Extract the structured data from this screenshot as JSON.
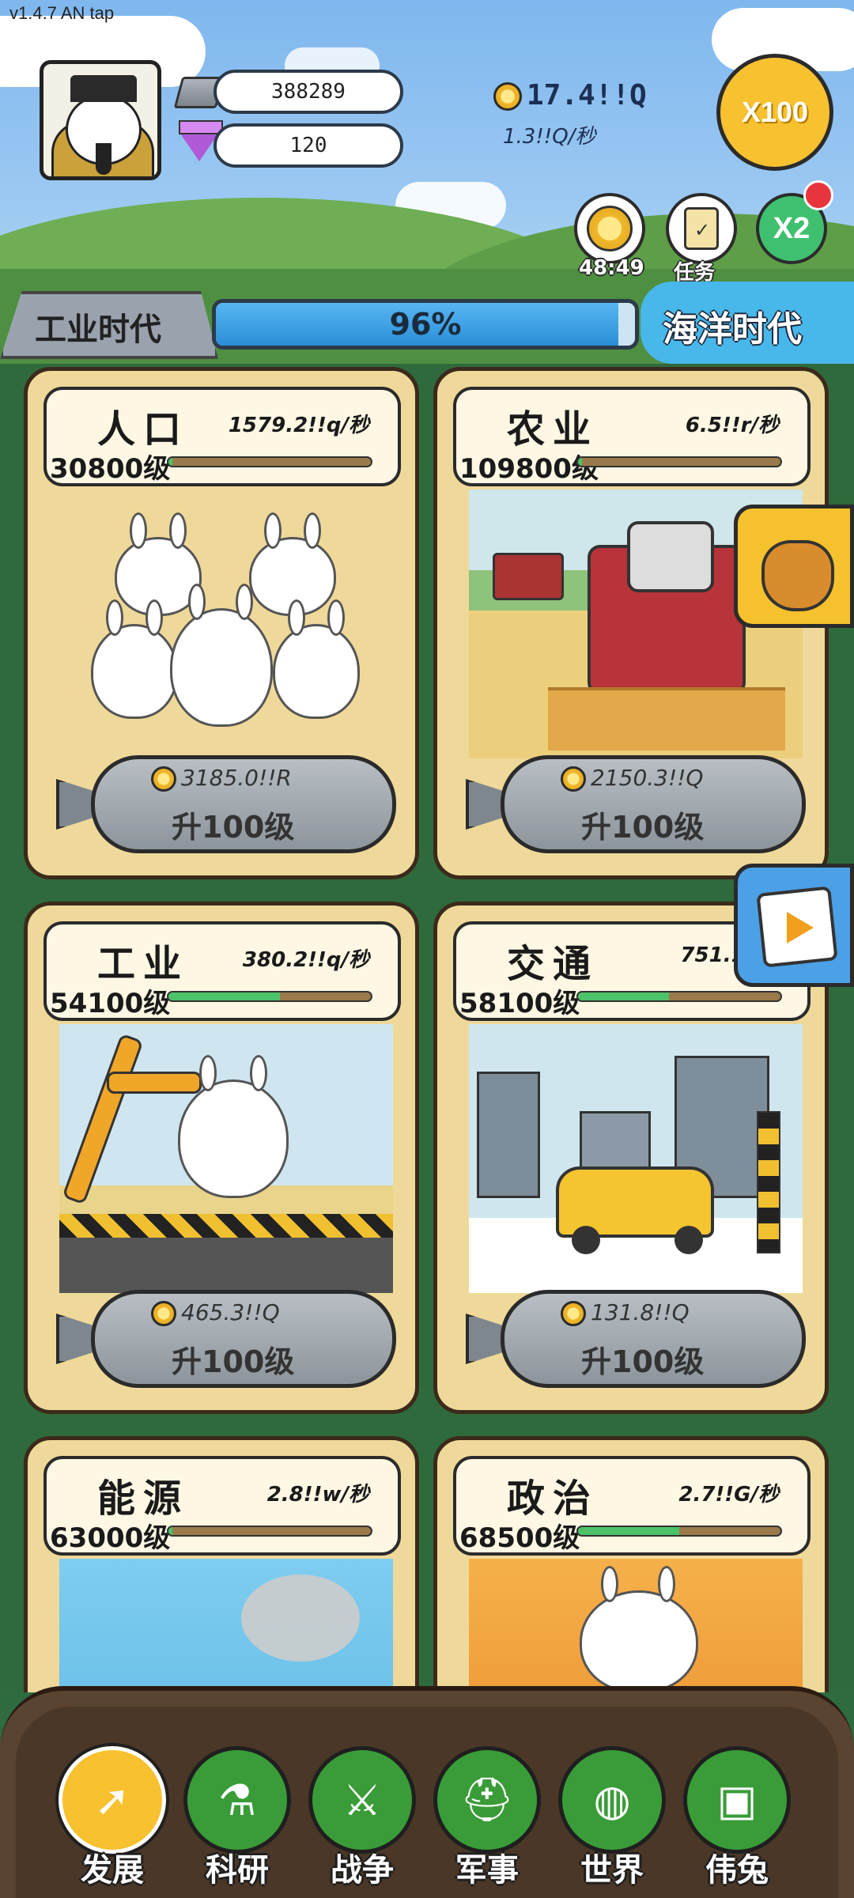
{
  "version": "v1.4.7 AN tap",
  "resources": {
    "silver": "388289",
    "gems": "120",
    "gold_total": "17.4!!Q",
    "gold_rate": "1.3!!Q/秒"
  },
  "buttons": {
    "x100": "X100",
    "timer": "48:49",
    "task": "任务",
    "x2": "X2"
  },
  "era": {
    "current": "工业时代",
    "progress_text": "96%",
    "progress": 0.96,
    "next": "海洋时代"
  },
  "cards": [
    {
      "title": "人口",
      "rate": "1579.2!!q/秒",
      "level": "30800级",
      "cost": "3185.0!!R",
      "upgrade": "升100级",
      "level_fill": 0.02
    },
    {
      "title": "农业",
      "rate": "6.5!!r/秒",
      "level": "109800级",
      "cost": "2150.3!!Q",
      "upgrade": "升100级",
      "level_fill": 0.02
    },
    {
      "title": "工业",
      "rate": "380.2!!q/秒",
      "level": "54100级",
      "cost": "465.3!!Q",
      "upgrade": "升100级",
      "level_fill": 0.55
    },
    {
      "title": "交通",
      "rate": "751.1!!q",
      "level": "58100级",
      "cost": "131.8!!Q",
      "upgrade": "升100级",
      "level_fill": 0.45
    },
    {
      "title": "能源",
      "rate": "2.8!!w/秒",
      "level": "63000级",
      "cost": "",
      "upgrade": "",
      "level_fill": 0.02
    },
    {
      "title": "政治",
      "rate": "2.7!!G/秒",
      "level": "68500级",
      "cost": "",
      "upgrade": "",
      "level_fill": 0.5
    }
  ],
  "nav": [
    {
      "label": "发展",
      "icon": "development-icon"
    },
    {
      "label": "科研",
      "icon": "research-icon"
    },
    {
      "label": "战争",
      "icon": "war-icon"
    },
    {
      "label": "军事",
      "icon": "military-icon"
    },
    {
      "label": "世界",
      "icon": "world-icon"
    },
    {
      "label": "伟兔",
      "icon": "great-rabbit-icon"
    }
  ],
  "colors": {
    "gold": "#f7c12f",
    "progress_blue": "#2a8ed8",
    "level_green": "#4cc26a",
    "card_bg": "#efd99a",
    "nav_green": "#3a9c38"
  }
}
